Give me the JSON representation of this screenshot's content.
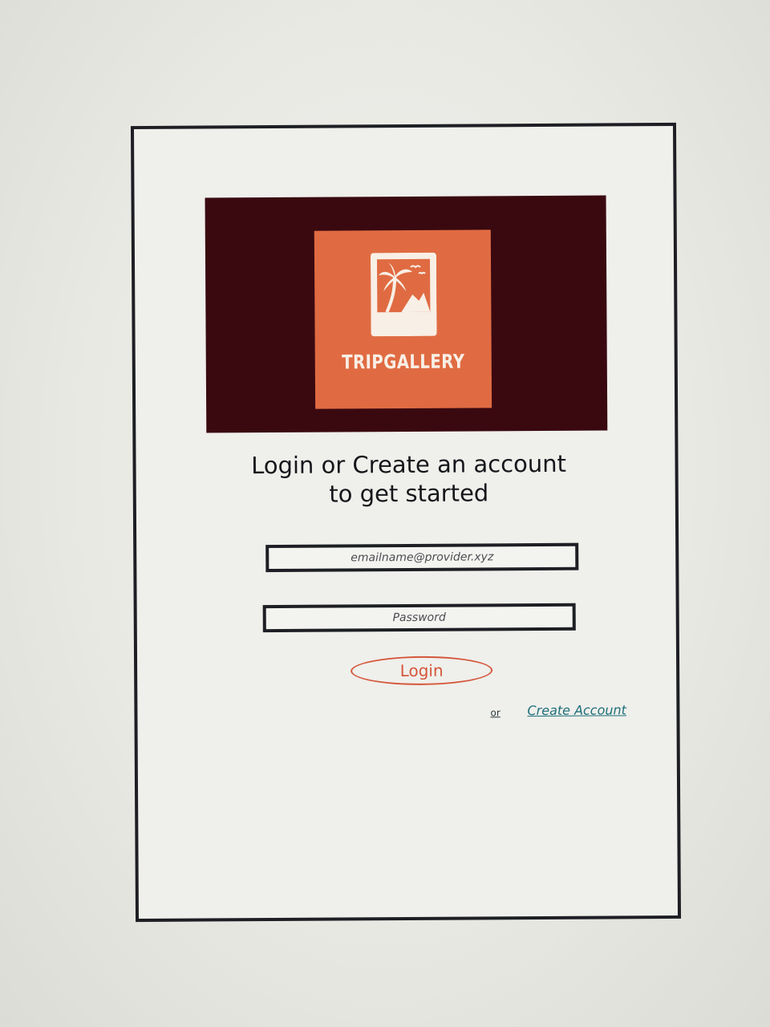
{
  "brand": {
    "name": "TRIPGALLERY",
    "colors": {
      "banner_bg": "#3a0910",
      "logo_tile": "#e06b42",
      "accent": "#d5563a",
      "link": "#1e6f7a"
    },
    "logo_icon": "palm-tree-photo-icon"
  },
  "heading": {
    "line1": "Login or Create an account",
    "line2": "to get started"
  },
  "form": {
    "email_placeholder": "emailname@provider.xyz",
    "password_placeholder": "Password",
    "login_label": "Login"
  },
  "footer": {
    "or_text": "or",
    "create_account_label": "Create Account"
  }
}
